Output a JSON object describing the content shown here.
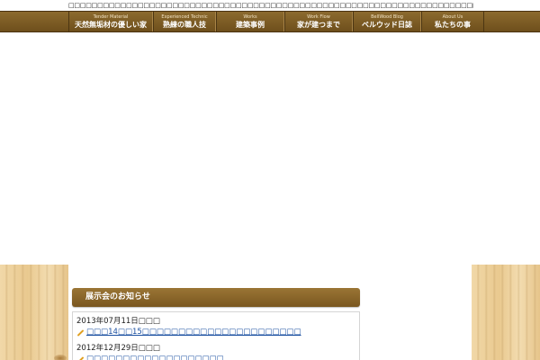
{
  "header": {
    "tagline": "□□□□□□□□□□□□□□□□□□□□□□□□□□□□□□□□□□□□□□□□□□□□□□□□□□□□□□□□□□□□□□□□□□□□□□□□□□□□□□"
  },
  "nav": {
    "items": [
      {
        "sub": "Tender Material",
        "label": "天然無垢材の優しい家"
      },
      {
        "sub": "Experienced Technic",
        "label": "熟練の職人技"
      },
      {
        "sub": "Works",
        "label": "建築事例"
      },
      {
        "sub": "Work Flow",
        "label": "家が建つまで"
      },
      {
        "sub": "BellWood Blog",
        "label": "ベルウッド日誌"
      },
      {
        "sub": "About Us",
        "label": "私たちの事"
      }
    ]
  },
  "section": {
    "title": "展示会のお知らせ"
  },
  "news": [
    {
      "date": "2013年07月11日□□□",
      "link": "□□□14□□15□□□□□□□□□□□□□□□□□□□□□□"
    },
    {
      "date": "2012年12月29日□□□",
      "link": "□□□□□□□□□□□□□□□□□□□"
    }
  ],
  "colors": {
    "nav_bg": "#7a5a24",
    "heading_bg": "#8a6a2c",
    "link": "#1a4fa0"
  }
}
